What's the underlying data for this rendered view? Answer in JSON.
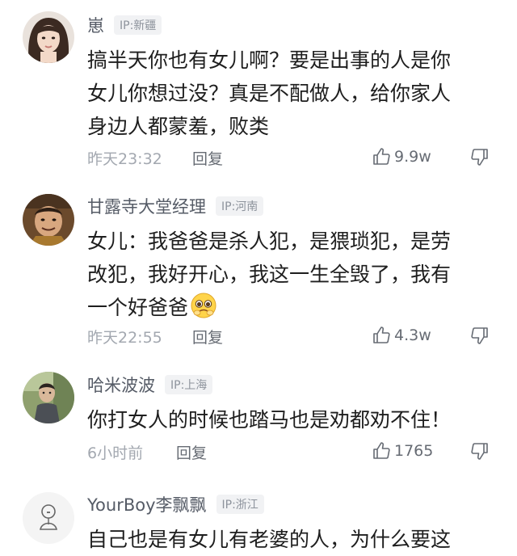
{
  "comments": [
    {
      "username": "崽",
      "ip": "IP:新疆",
      "lines": [
        "搞半天你也有女儿啊？要是出事的人是你",
        "女儿你想过没？真是不配做人，给你家人",
        "身边人都蒙羞，败类"
      ],
      "time": "昨天23:32",
      "reply": "回复",
      "likes": "9.9w"
    },
    {
      "username": "甘露寺大堂经理",
      "ip": "IP:河南",
      "lines": [
        "女儿：我爸爸是杀人犯，是猥琐犯，是劳",
        "改犯，我好开心，我这一生全毁了，我有",
        "一个好爸爸"
      ],
      "emoji": "pleading-face-emoji",
      "time": "昨天22:55",
      "reply": "回复",
      "likes": "4.3w"
    },
    {
      "username": "哈米波波",
      "ip": "IP:上海",
      "lines": [
        "你打女人的时候也踏马也是劝都劝不住！"
      ],
      "time": "6小时前",
      "reply": "回复",
      "likes": "1765"
    },
    {
      "username": "YourBoy李飘飘",
      "ip": "IP:浙江",
      "lines": [
        "自己也是有女儿有老婆的人，为什么要这"
      ]
    }
  ],
  "icons": {
    "like": "thumbs-up-icon",
    "dislike": "thumbs-down-icon"
  }
}
